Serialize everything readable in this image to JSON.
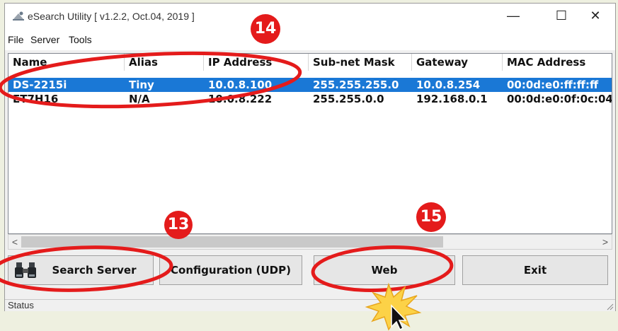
{
  "window": {
    "title": "eSearch Utility [ v1.2.2, Oct.04, 2019 ]",
    "minimize_glyph": "—",
    "maximize_glyph": "☐",
    "close_glyph": "✕"
  },
  "menu": [
    "File",
    "Server",
    "Tools"
  ],
  "table": {
    "columns": [
      "Name",
      "Alias",
      "IP Address",
      "Sub-net Mask",
      "Gateway",
      "MAC Address"
    ],
    "rows": [
      {
        "name": "DS-2215i",
        "alias": "Tiny",
        "ip": "10.0.8.100",
        "mask": "255.255.255.0",
        "gateway": "10.0.8.254",
        "mac": "00:0d:e0:ff:ff:ff",
        "selected": true
      },
      {
        "name": "ET7H16",
        "alias": "N/A",
        "ip": "10.0.8.222",
        "mask": "255.255.0.0",
        "gateway": "192.168.0.1",
        "mac": "00:0d:e0:0f:0c:04",
        "selected": false
      }
    ]
  },
  "scrollbar": {
    "left_arrow": "<",
    "right_arrow": ">"
  },
  "buttons": {
    "search": "Search Server",
    "config": "Configuration (UDP)",
    "web": "Web",
    "exit": "Exit"
  },
  "status": "Status",
  "annotations": {
    "step13": "13",
    "step14": "14",
    "step15": "15"
  },
  "colors": {
    "selection": "#1a78d6",
    "highlight_ring": "#e41b1b",
    "step_circle": "#e41b1b"
  },
  "icons": [
    "app-icon",
    "binoculars-icon",
    "mouse-cursor-icon",
    "click-burst-icon",
    "resize-grip-icon"
  ]
}
